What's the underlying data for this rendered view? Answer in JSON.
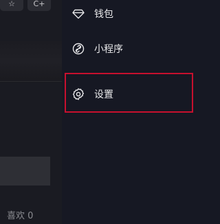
{
  "left": {
    "star_icon": "star-icon",
    "add_icon": "add-user-icon",
    "add_label": "C+",
    "likes_text": "喜欢 0"
  },
  "menu": {
    "items": [
      {
        "label": "钱包",
        "icon": "diamond-icon"
      },
      {
        "label": "小程序",
        "icon": "link-icon"
      },
      {
        "label": "设置",
        "icon": "gear-icon"
      }
    ]
  },
  "colors": {
    "background": "#161823",
    "text": "#e8e8ea",
    "highlight": "#c8102e"
  }
}
